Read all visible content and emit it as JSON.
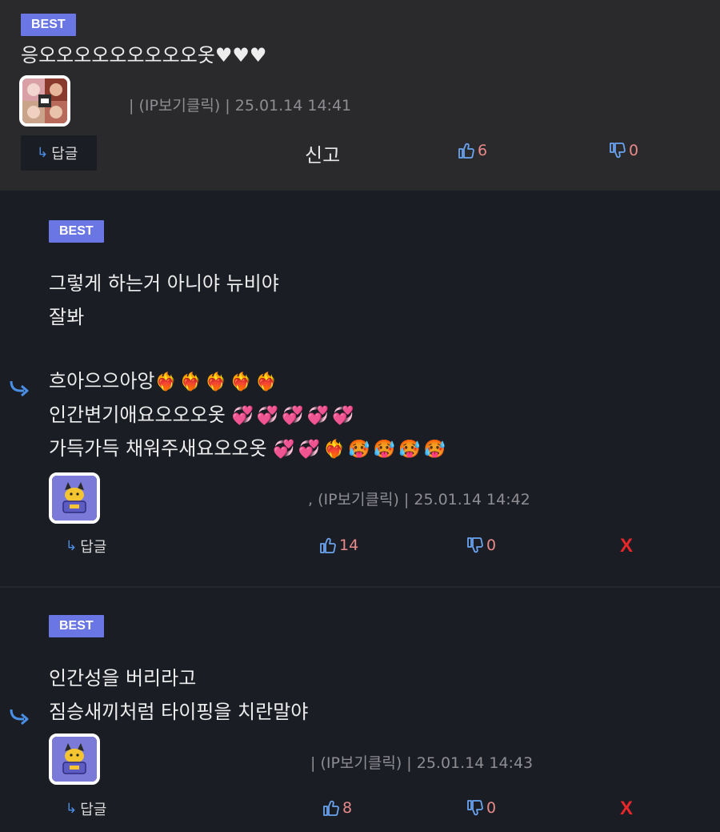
{
  "comments": [
    {
      "badge": "BEST",
      "lines": [
        "응오오오오오오오오오옷♥♥♥"
      ],
      "meta": "| (IP보기클릭) | 25.01.14 14:41",
      "reply_label": "답글",
      "report_label": "신고",
      "upvotes": "6",
      "downvotes": "0"
    },
    {
      "badge": "BEST",
      "lines": [
        "그렇게 하는거 아니야 뉴비야",
        "잘봐",
        "",
        "흐아으으아앙",
        "인간변기애요오오오옷",
        "가득가득 채워주새요오오옷"
      ],
      "emojis": {
        "line4": "❤️‍🔥❤️‍🔥❤️‍🔥❤️‍🔥❤️‍🔥",
        "line5": "💞💞💞💞💞",
        "line6": "💞💞❤️‍🔥🥵🥵🥵🥵"
      },
      "meta": ", (IP보기클릭) | 25.01.14 14:42",
      "reply_label": "답글",
      "upvotes": "14",
      "downvotes": "0",
      "delete_label": "X"
    },
    {
      "badge": "BEST",
      "lines": [
        "인간성을 버리라고",
        "짐승새끼처럼 타이핑을 치란말야"
      ],
      "meta": "| (IP보기클릭) | 25.01.14 14:43",
      "reply_label": "답글",
      "upvotes": "8",
      "downvotes": "0",
      "delete_label": "X"
    }
  ],
  "icons": {
    "reply": "reply-arrow-icon",
    "upvote": "thumbs-up-icon",
    "downvote": "thumbs-down-icon",
    "nested": "nested-reply-arrow-icon"
  },
  "colors": {
    "badge": "#6a76e3",
    "upcount": "#e88a8a",
    "delete": "#e8272b",
    "reply_arrow": "#4a8fe6"
  }
}
